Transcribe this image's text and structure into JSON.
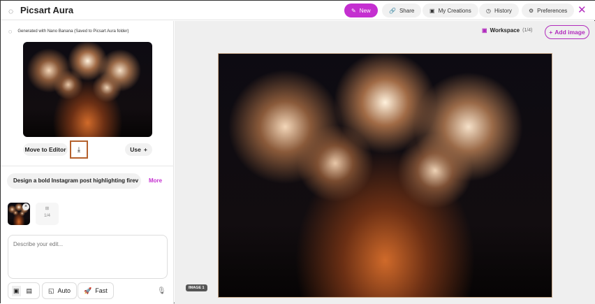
{
  "header": {
    "title": "Picsart Aura",
    "new": "New",
    "share": "Share",
    "my_creations": "My Creations",
    "history": "History",
    "preferences": "Preferences",
    "close": "✕"
  },
  "left": {
    "generated": "Generated with Nano Banana (Saved to Picsart Aura folder)",
    "move_to_editor": "Move to Editor",
    "use": "Use",
    "prompt": "Design a bold Instagram post highlighting firev",
    "more": "More",
    "slot_count": "1/4",
    "input_placeholder": "Describe your edit...",
    "auto": "Auto",
    "fast": "Fast"
  },
  "workspace": {
    "label": "Workspace",
    "count": "(1/4)",
    "add_image": "Add image",
    "image_badge": "IMAGE 1"
  },
  "colors": {
    "accent": "#c42fd0",
    "highlight": "#b5612d"
  }
}
